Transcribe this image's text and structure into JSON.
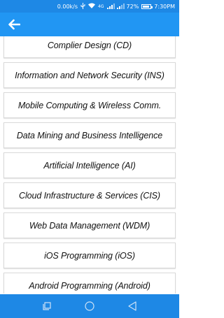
{
  "status_bar": {
    "speed": "0.00k/s",
    "network_type": "4G",
    "battery": "72%",
    "time": "7:30PM",
    "icons": [
      "usb-icon",
      "wifi-icon",
      "signal-icon",
      "signal-icon",
      "battery-icon"
    ]
  },
  "app_bar": {
    "back_icon": "arrow-left-icon"
  },
  "courses": [
    "Complier Design (CD)",
    "Information and Network Security (INS)",
    "Mobile Computing & Wireless Comm.",
    "Data Mining and Business Intelligence",
    "Artificial Intelligence (AI)",
    "Cloud Infrastructure & Services (CIS)",
    "Web Data Management (WDM)",
    "iOS Programming (iOS)",
    "Android Programming (Android)"
  ],
  "nav_bar": {
    "icons": [
      "recent-apps-icon",
      "home-icon",
      "back-icon"
    ]
  },
  "colors": {
    "status_bar": "#1e88e5",
    "app_bar": "#2196f3",
    "nav_bar": "#1e88e5"
  }
}
